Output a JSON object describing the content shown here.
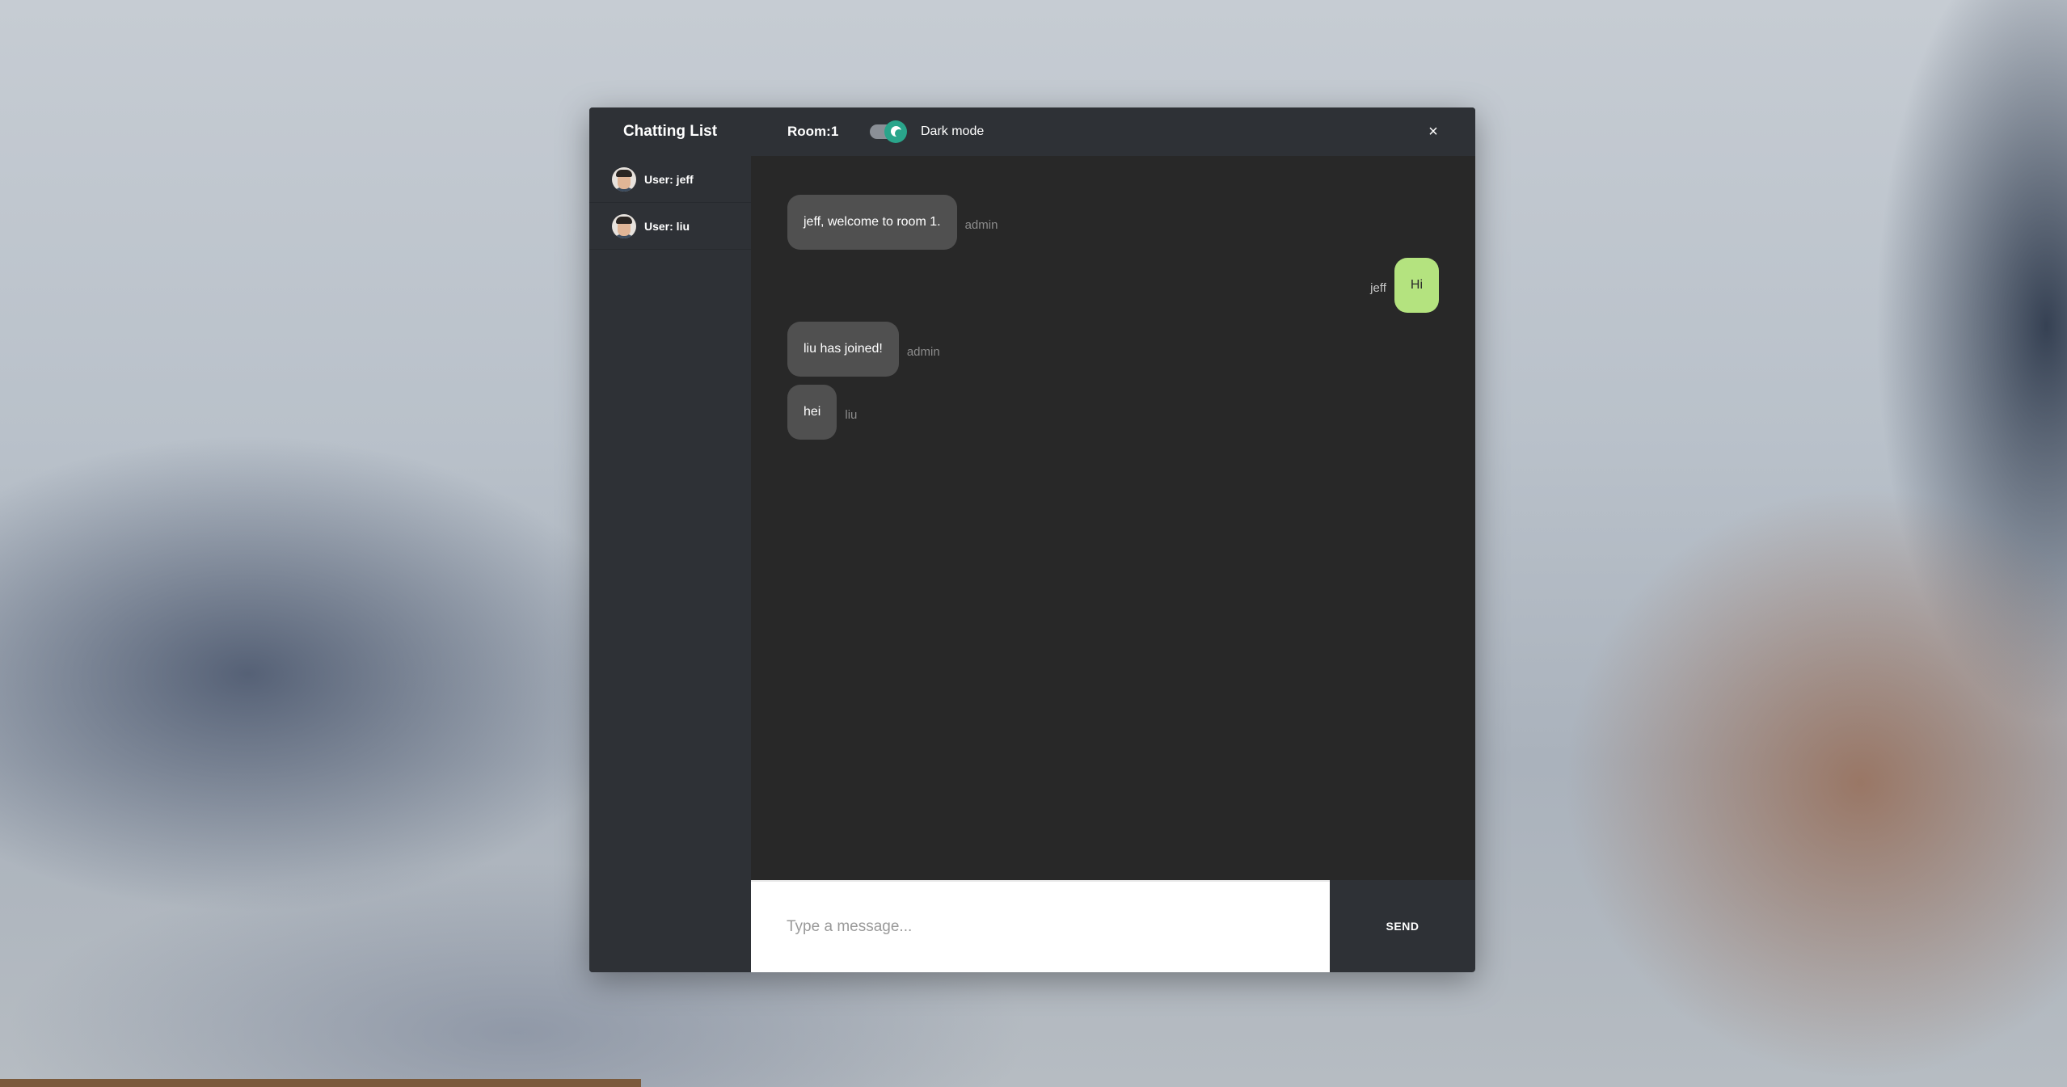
{
  "sidebar": {
    "title": "Chatting List",
    "users": [
      {
        "label": "User: jeff"
      },
      {
        "label": "User: liu"
      }
    ]
  },
  "header": {
    "room": "Room:1",
    "dark_mode_label": "Dark mode",
    "dark_mode_on": true,
    "close_glyph": "×"
  },
  "messages": [
    {
      "text": "jeff, welcome to room 1.",
      "sender": "admin",
      "own": false
    },
    {
      "text": "Hi",
      "sender": "jeff",
      "own": true
    },
    {
      "text": "liu has joined!",
      "sender": "admin",
      "own": false
    },
    {
      "text": "hei",
      "sender": "liu",
      "own": false
    }
  ],
  "composer": {
    "placeholder": "Type a message...",
    "value": "",
    "send_label": "SEND"
  },
  "colors": {
    "panel": "#2e3136",
    "chat_bg": "#282828",
    "bubble_other": "#505050",
    "bubble_self": "#b4e37f",
    "toggle_accent": "#2aa58b"
  }
}
